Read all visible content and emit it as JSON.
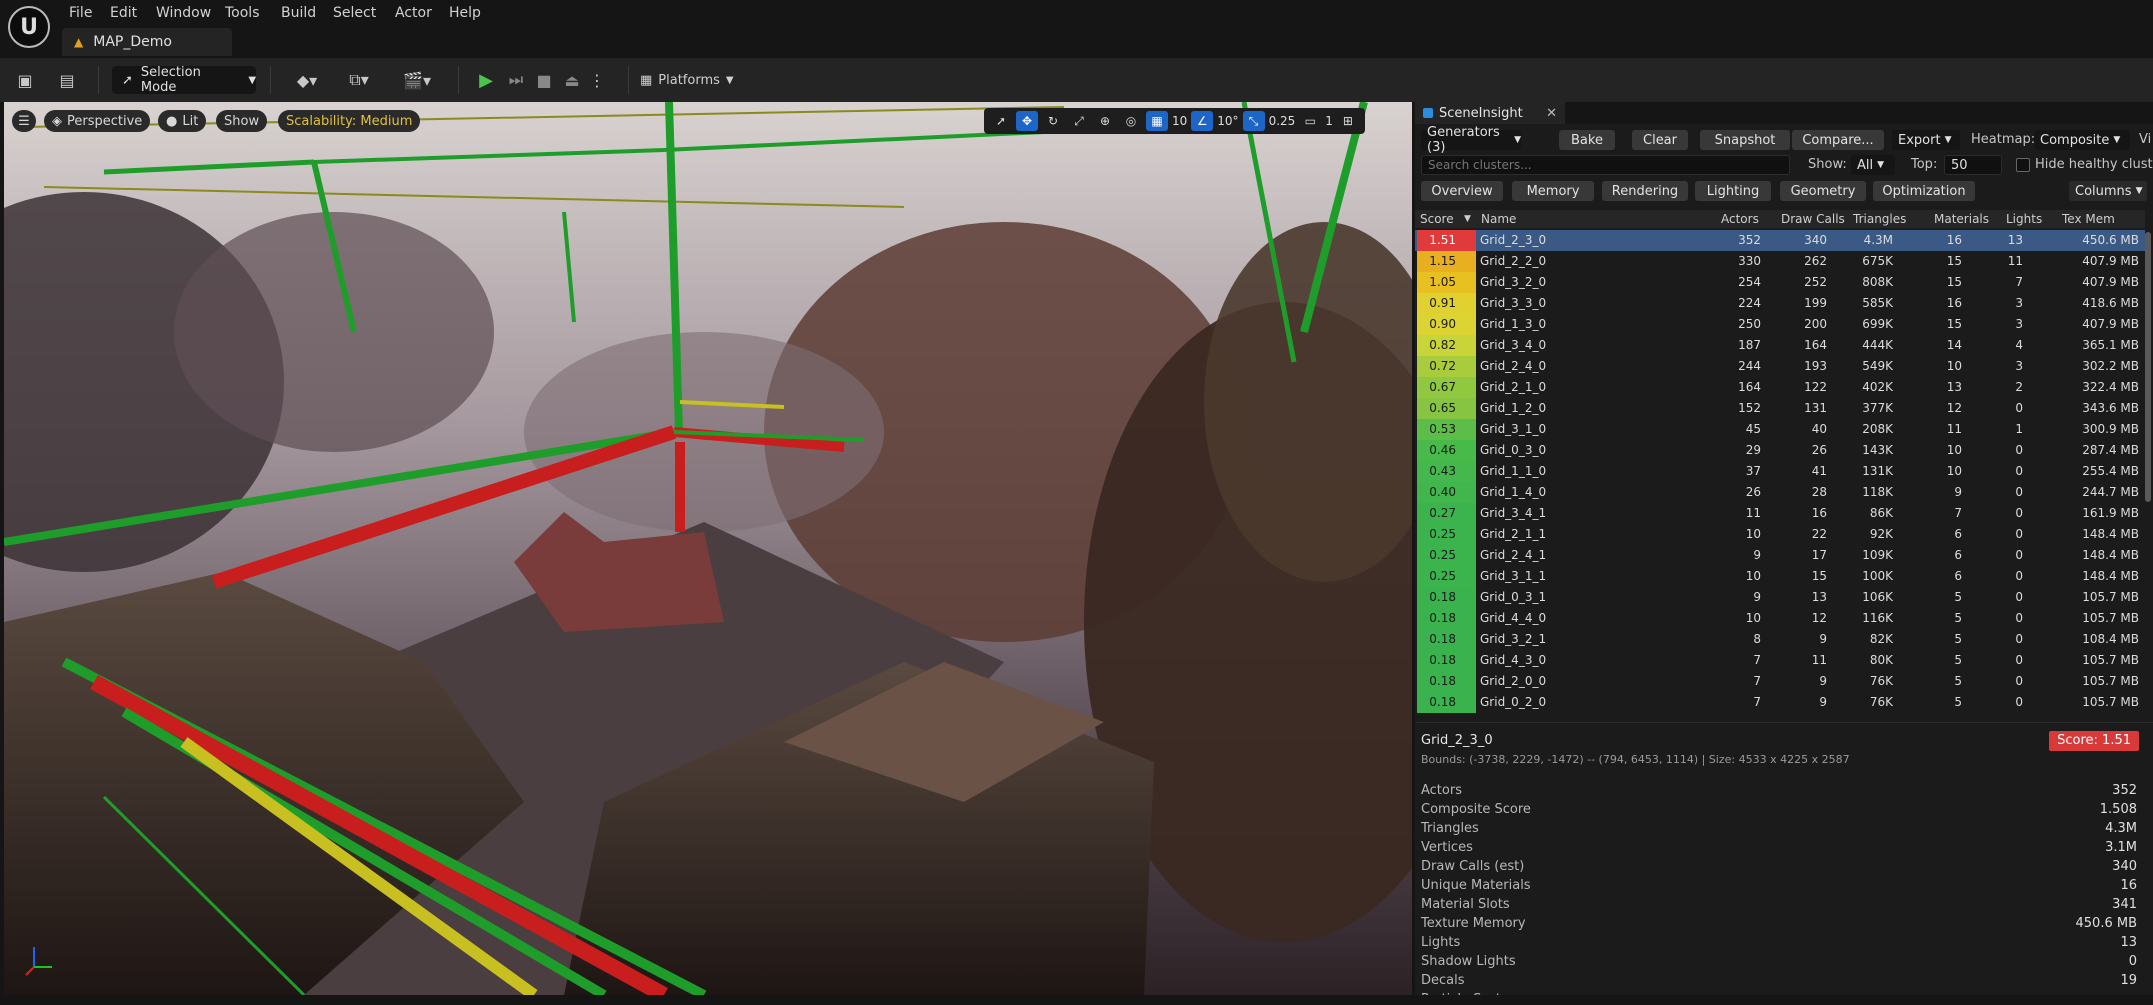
{
  "menu": {
    "items": [
      "File",
      "Edit",
      "Window",
      "Tools",
      "Build",
      "Select",
      "Actor",
      "Help"
    ],
    "map_tab": "MAP_Demo"
  },
  "toolbar": {
    "selection_mode": "Selection Mode",
    "platforms": "Platforms"
  },
  "viewport": {
    "perspective": "Perspective",
    "lit": "Lit",
    "show": "Show",
    "scalability": "Scalability: Medium",
    "grid_snap": "10",
    "rotation_snap": "10°",
    "scale_snap": "0.25",
    "camera_speed": "1",
    "accent_red": "#c81e1e",
    "accent_green": "#1f9d2a",
    "accent_yellow": "#c8c020"
  },
  "panel": {
    "tab_title": "SceneInsight",
    "generators": "Generators (3)",
    "bake": "Bake",
    "clear": "Clear",
    "snapshot": "Snapshot",
    "compare": "Compare...",
    "export": "Export",
    "heatmap_label": "Heatmap:",
    "heatmap_value": "Composite",
    "vi_cut": "Vi",
    "search_placeholder": "Search clusters...",
    "show_label": "Show:",
    "show_value": "All",
    "top_label": "Top:",
    "top_value": "50",
    "hide_healthy": "Hide healthy clusters",
    "tabs": [
      "Overview",
      "Memory",
      "Rendering",
      "Lighting",
      "Geometry",
      "Optimization"
    ],
    "columns": "Columns",
    "headers": [
      "Score",
      "Name",
      "Actors",
      "Draw Calls",
      "Triangles",
      "Materials",
      "Lights",
      "Tex Mem"
    ],
    "rows": [
      {
        "score": "1.51",
        "name": "Grid_2_3_0",
        "actors": "352",
        "draw": "340",
        "tris": "4.3M",
        "mats": "16",
        "lights": "13",
        "tex": "450.6 MB",
        "color": "#e03a3a"
      },
      {
        "score": "1.15",
        "name": "Grid_2_2_0",
        "actors": "330",
        "draw": "262",
        "tris": "675K",
        "mats": "15",
        "lights": "11",
        "tex": "407.9 MB",
        "color": "#e8b020"
      },
      {
        "score": "1.05",
        "name": "Grid_3_2_0",
        "actors": "254",
        "draw": "252",
        "tris": "808K",
        "mats": "15",
        "lights": "7",
        "tex": "407.9 MB",
        "color": "#e8c020"
      },
      {
        "score": "0.91",
        "name": "Grid_3_3_0",
        "actors": "224",
        "draw": "199",
        "tris": "585K",
        "mats": "16",
        "lights": "3",
        "tex": "418.6 MB",
        "color": "#e0d030"
      },
      {
        "score": "0.90",
        "name": "Grid_1_3_0",
        "actors": "250",
        "draw": "200",
        "tris": "699K",
        "mats": "15",
        "lights": "3",
        "tex": "407.9 MB",
        "color": "#dcd432"
      },
      {
        "score": "0.82",
        "name": "Grid_3_4_0",
        "actors": "187",
        "draw": "164",
        "tris": "444K",
        "mats": "14",
        "lights": "4",
        "tex": "365.1 MB",
        "color": "#c8d438"
      },
      {
        "score": "0.72",
        "name": "Grid_2_4_0",
        "actors": "244",
        "draw": "193",
        "tris": "549K",
        "mats": "10",
        "lights": "3",
        "tex": "302.2 MB",
        "color": "#a8cc3c"
      },
      {
        "score": "0.67",
        "name": "Grid_2_1_0",
        "actors": "164",
        "draw": "122",
        "tris": "402K",
        "mats": "13",
        "lights": "2",
        "tex": "322.4 MB",
        "color": "#90c840"
      },
      {
        "score": "0.65",
        "name": "Grid_1_2_0",
        "actors": "152",
        "draw": "131",
        "tris": "377K",
        "mats": "12",
        "lights": "0",
        "tex": "343.6 MB",
        "color": "#86c442"
      },
      {
        "score": "0.53",
        "name": "Grid_3_1_0",
        "actors": "45",
        "draw": "40",
        "tris": "208K",
        "mats": "11",
        "lights": "1",
        "tex": "300.9 MB",
        "color": "#5cbe48"
      },
      {
        "score": "0.46",
        "name": "Grid_0_3_0",
        "actors": "29",
        "draw": "26",
        "tris": "143K",
        "mats": "10",
        "lights": "0",
        "tex": "287.4 MB",
        "color": "#48ba4a"
      },
      {
        "score": "0.43",
        "name": "Grid_1_1_0",
        "actors": "37",
        "draw": "41",
        "tris": "131K",
        "mats": "10",
        "lights": "0",
        "tex": "255.4 MB",
        "color": "#44b84c"
      },
      {
        "score": "0.40",
        "name": "Grid_1_4_0",
        "actors": "26",
        "draw": "28",
        "tris": "118K",
        "mats": "9",
        "lights": "0",
        "tex": "244.7 MB",
        "color": "#40b64c"
      },
      {
        "score": "0.27",
        "name": "Grid_3_4_1",
        "actors": "11",
        "draw": "16",
        "tris": "86K",
        "mats": "7",
        "lights": "0",
        "tex": "161.9 MB",
        "color": "#3cb44e"
      },
      {
        "score": "0.25",
        "name": "Grid_2_1_1",
        "actors": "10",
        "draw": "22",
        "tris": "92K",
        "mats": "6",
        "lights": "0",
        "tex": "148.4 MB",
        "color": "#3cb44e"
      },
      {
        "score": "0.25",
        "name": "Grid_2_4_1",
        "actors": "9",
        "draw": "17",
        "tris": "109K",
        "mats": "6",
        "lights": "0",
        "tex": "148.4 MB",
        "color": "#3cb44e"
      },
      {
        "score": "0.25",
        "name": "Grid_3_1_1",
        "actors": "10",
        "draw": "15",
        "tris": "100K",
        "mats": "6",
        "lights": "0",
        "tex": "148.4 MB",
        "color": "#3cb44e"
      },
      {
        "score": "0.18",
        "name": "Grid_0_3_1",
        "actors": "9",
        "draw": "13",
        "tris": "106K",
        "mats": "5",
        "lights": "0",
        "tex": "105.7 MB",
        "color": "#3ab24e"
      },
      {
        "score": "0.18",
        "name": "Grid_4_4_0",
        "actors": "10",
        "draw": "12",
        "tris": "116K",
        "mats": "5",
        "lights": "0",
        "tex": "105.7 MB",
        "color": "#3ab24e"
      },
      {
        "score": "0.18",
        "name": "Grid_3_2_1",
        "actors": "8",
        "draw": "9",
        "tris": "82K",
        "mats": "5",
        "lights": "0",
        "tex": "108.4 MB",
        "color": "#3ab24e"
      },
      {
        "score": "0.18",
        "name": "Grid_4_3_0",
        "actors": "7",
        "draw": "11",
        "tris": "80K",
        "mats": "5",
        "lights": "0",
        "tex": "105.7 MB",
        "color": "#3ab24e"
      },
      {
        "score": "0.18",
        "name": "Grid_2_0_0",
        "actors": "7",
        "draw": "9",
        "tris": "76K",
        "mats": "5",
        "lights": "0",
        "tex": "105.7 MB",
        "color": "#3ab24e"
      },
      {
        "score": "0.18",
        "name": "Grid_0_2_0",
        "actors": "7",
        "draw": "9",
        "tris": "76K",
        "mats": "5",
        "lights": "0",
        "tex": "105.7 MB",
        "color": "#3ab24e"
      }
    ],
    "details": {
      "title": "Grid_2_3_0",
      "score": "Score: 1.51",
      "bounds": "Bounds: (-3738, 2229, -1472) -- (794, 6453, 1114)  |  Size: 4533 x 4225 x 2587",
      "stats": [
        {
          "k": "Actors",
          "v": "352"
        },
        {
          "k": "Composite Score",
          "v": "1.508"
        },
        {
          "k": "Triangles",
          "v": "4.3M"
        },
        {
          "k": "Vertices",
          "v": "3.1M"
        },
        {
          "k": "Draw Calls (est)",
          "v": "340"
        },
        {
          "k": "Unique Materials",
          "v": "16"
        },
        {
          "k": "Material Slots",
          "v": "341"
        },
        {
          "k": "Texture Memory",
          "v": "450.6 MB"
        },
        {
          "k": "Lights",
          "v": "13"
        },
        {
          "k": "Shadow Lights",
          "v": "0"
        },
        {
          "k": "Decals",
          "v": "19"
        },
        {
          "k": "Particle Systems",
          "v": ""
        }
      ]
    }
  }
}
